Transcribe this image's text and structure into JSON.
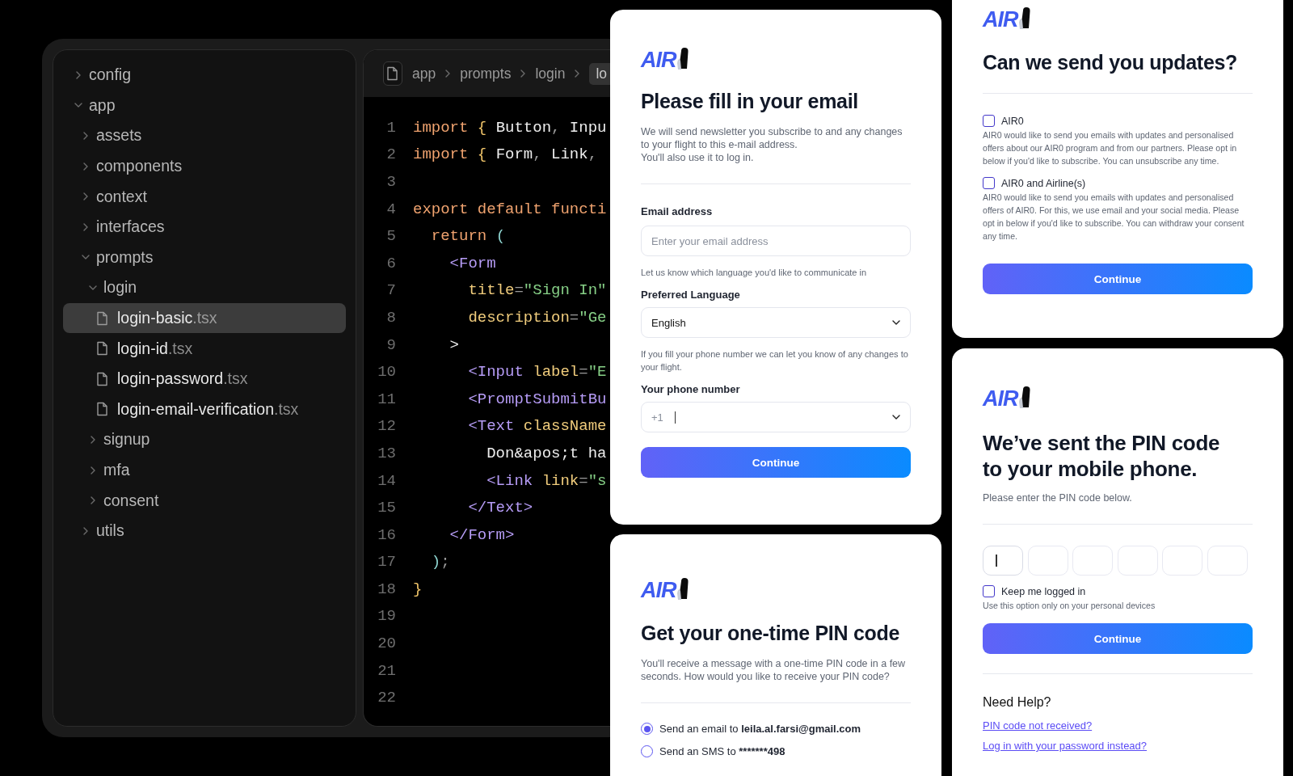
{
  "editor": {
    "file_tree": [
      {
        "name": "config",
        "kind": "folder",
        "expanded": false,
        "selected": false
      },
      {
        "name": "app",
        "kind": "folder",
        "expanded": true,
        "selected": false,
        "children": [
          {
            "name": "assets",
            "kind": "folder",
            "expanded": false,
            "selected": false
          },
          {
            "name": "components",
            "kind": "folder",
            "expanded": false,
            "selected": false
          },
          {
            "name": "context",
            "kind": "folder",
            "expanded": false,
            "selected": false
          },
          {
            "name": "interfaces",
            "kind": "folder",
            "expanded": false,
            "selected": false
          },
          {
            "name": "prompts",
            "kind": "folder",
            "expanded": true,
            "selected": false,
            "children": [
              {
                "name": "login",
                "kind": "folder",
                "expanded": true,
                "selected": false,
                "children": [
                  {
                    "name": "login-basic",
                    "ext": ".tsx",
                    "kind": "file",
                    "selected": true
                  },
                  {
                    "name": "login-id",
                    "ext": ".tsx",
                    "kind": "file",
                    "selected": false
                  },
                  {
                    "name": "login-password",
                    "ext": ".tsx",
                    "kind": "file",
                    "selected": false
                  },
                  {
                    "name": "login-email-verification",
                    "ext": ".tsx",
                    "kind": "file",
                    "selected": false
                  }
                ]
              },
              {
                "name": "signup",
                "kind": "folder",
                "expanded": false,
                "selected": false
              },
              {
                "name": "mfa",
                "kind": "folder",
                "expanded": false,
                "selected": false
              },
              {
                "name": "consent",
                "kind": "folder",
                "expanded": false,
                "selected": false
              }
            ]
          },
          {
            "name": "utils",
            "kind": "folder",
            "expanded": false,
            "selected": false
          }
        ]
      }
    ],
    "breadcrumb": [
      "app",
      "prompts",
      "login"
    ],
    "open_tab": "lo",
    "code_lines": [
      {
        "number": "1",
        "tokens": [
          {
            "kind": "keyword",
            "text": "import "
          },
          {
            "kind": "brace",
            "text": "{"
          },
          {
            "kind": "plain",
            "text": " Button"
          },
          {
            "kind": "punct",
            "text": ","
          },
          {
            "kind": "plain",
            "text": " Inpu"
          }
        ]
      },
      {
        "number": "2",
        "tokens": [
          {
            "kind": "keyword",
            "text": "import "
          },
          {
            "kind": "brace",
            "text": "{"
          },
          {
            "kind": "plain",
            "text": " Form"
          },
          {
            "kind": "punct",
            "text": ","
          },
          {
            "kind": "plain",
            "text": " Link"
          },
          {
            "kind": "punct",
            "text": ","
          }
        ]
      },
      {
        "number": "3"
      },
      {
        "number": "4",
        "tokens": [
          {
            "kind": "keyword",
            "text": "export default functi"
          }
        ]
      },
      {
        "number": "5",
        "tokens": [
          {
            "kind": "keyword",
            "text": "  return "
          },
          {
            "kind": "paren",
            "text": "("
          }
        ]
      },
      {
        "number": "6",
        "tokens": [
          {
            "kind": "tag",
            "text": "    <Form"
          }
        ]
      },
      {
        "number": "7",
        "tokens": [
          {
            "kind": "attr",
            "text": "      title"
          },
          {
            "kind": "punct",
            "text": "="
          },
          {
            "kind": "string",
            "text": "\"Sign In\""
          }
        ]
      },
      {
        "number": "8",
        "tokens": [
          {
            "kind": "attr",
            "text": "      description"
          },
          {
            "kind": "punct",
            "text": "="
          },
          {
            "kind": "string",
            "text": "\"Ge"
          }
        ]
      },
      {
        "number": "9",
        "tokens": [
          {
            "kind": "plain",
            "text": "    >"
          }
        ]
      },
      {
        "number": "10",
        "tokens": [
          {
            "kind": "tag",
            "text": "      <Input "
          },
          {
            "kind": "attr",
            "text": "label"
          },
          {
            "kind": "punct",
            "text": "="
          },
          {
            "kind": "string",
            "text": "\"E"
          }
        ]
      },
      {
        "number": "11",
        "tokens": [
          {
            "kind": "tag",
            "text": "      <PromptSubmitBu"
          }
        ]
      },
      {
        "number": "12",
        "tokens": [
          {
            "kind": "tag",
            "text": "      <Text "
          },
          {
            "kind": "attr",
            "text": "className"
          }
        ]
      },
      {
        "number": "13",
        "tokens": [
          {
            "kind": "plain",
            "text": "        Don&apos;t ha"
          }
        ]
      },
      {
        "number": "14",
        "tokens": [
          {
            "kind": "tag",
            "text": "        <Link "
          },
          {
            "kind": "attr",
            "text": "link"
          },
          {
            "kind": "punct",
            "text": "="
          },
          {
            "kind": "string",
            "text": "\"s"
          }
        ]
      },
      {
        "number": "15",
        "tokens": [
          {
            "kind": "tag",
            "text": "      </Text>"
          }
        ]
      },
      {
        "number": "16",
        "tokens": [
          {
            "kind": "tag",
            "text": "    </Form>"
          }
        ]
      },
      {
        "number": "17",
        "tokens": [
          {
            "kind": "paren",
            "text": "  )"
          },
          {
            "kind": "punct",
            "text": ";"
          }
        ]
      },
      {
        "number": "18",
        "tokens": [
          {
            "kind": "brace",
            "text": "}"
          }
        ]
      },
      {
        "number": "19"
      },
      {
        "number": "20"
      },
      {
        "number": "21"
      },
      {
        "number": "22"
      }
    ]
  },
  "cards": [
    {
      "kind": "email_form",
      "blocks": [
        {
          "kind": "logo",
          "text": "AIR"
        },
        {
          "kind": "title",
          "text": "Please fill in your email"
        },
        {
          "kind": "description",
          "text": "We will send newsletter you subscribe to and any changes to your flight to this e-mail address.\nYou'll also use it to log in."
        },
        {
          "kind": "divider"
        },
        {
          "kind": "label",
          "text": "Email address"
        },
        {
          "kind": "input",
          "placeholder": "Enter your email address"
        },
        {
          "kind": "hint",
          "text": "Let us know which language you'd like to communicate in"
        },
        {
          "kind": "label",
          "text": "Preferred Language"
        },
        {
          "kind": "select",
          "value": "English"
        },
        {
          "kind": "hint",
          "text": "If you fill your phone number we can let you know of any changes to your flight."
        },
        {
          "kind": "label",
          "text": "Your phone number"
        },
        {
          "kind": "phone",
          "prefix": "+1"
        },
        {
          "kind": "button",
          "label": "Continue"
        }
      ]
    },
    {
      "kind": "otp_choice",
      "blocks": [
        {
          "kind": "logo",
          "text": "AIR"
        },
        {
          "kind": "title",
          "text": "Get your one-time PIN code"
        },
        {
          "kind": "description",
          "text": "You'll receive a message with a one-time PIN code in a few seconds. How would you like to receive your PIN code?"
        },
        {
          "kind": "divider"
        },
        {
          "kind": "radio",
          "label": "Send an email to",
          "target": "leila.al.farsi@gmail.com",
          "selected": true
        },
        {
          "kind": "radio",
          "label": "Send an SMS to",
          "target": "*******498",
          "selected": false
        }
      ]
    },
    {
      "kind": "consent",
      "blocks": [
        {
          "kind": "logo",
          "text": "AIR"
        },
        {
          "kind": "title",
          "text": "Can we send you updates?"
        },
        {
          "kind": "divider"
        },
        {
          "kind": "checkbox",
          "label": "AIR0",
          "checked": false,
          "description": "AIR0 would like to send you emails with updates and personalised offers about our AIR0 program and from our partners. Please opt in below if you'd like to subscribe. You can unsubscribe any time."
        },
        {
          "kind": "checkbox",
          "label": "AIR0 and Airline(s)",
          "checked": false,
          "description": "AIR0 would like to send you emails with updates and personalised offers of AIR0. For this, we use email and your social media. Please opt in below if you'd like to subscribe. You can withdraw your consent any time."
        },
        {
          "kind": "button",
          "label": "Continue"
        }
      ]
    },
    {
      "kind": "pin_entry",
      "blocks": [
        {
          "kind": "logo",
          "text": "AIR"
        },
        {
          "kind": "title",
          "text": "We’ve sent the PIN code to your mobile phone."
        },
        {
          "kind": "description",
          "text": "Please enter the PIN code below."
        },
        {
          "kind": "divider"
        },
        {
          "kind": "pin",
          "cells": [
            {
              "focused": true
            },
            {
              "focused": false
            },
            {
              "focused": false
            },
            {
              "focused": false
            },
            {
              "focused": false
            },
            {
              "focused": false
            }
          ]
        },
        {
          "kind": "checkbox",
          "label": "Keep me logged in",
          "checked": false,
          "description": "Use this option only on your personal devices"
        },
        {
          "kind": "button",
          "label": "Continue"
        },
        {
          "kind": "divider"
        },
        {
          "kind": "heading",
          "text": "Need Help?"
        },
        {
          "kind": "link",
          "text": "PIN code not received?"
        },
        {
          "kind": "link",
          "text": "Log in with your password instead?"
        }
      ]
    }
  ]
}
